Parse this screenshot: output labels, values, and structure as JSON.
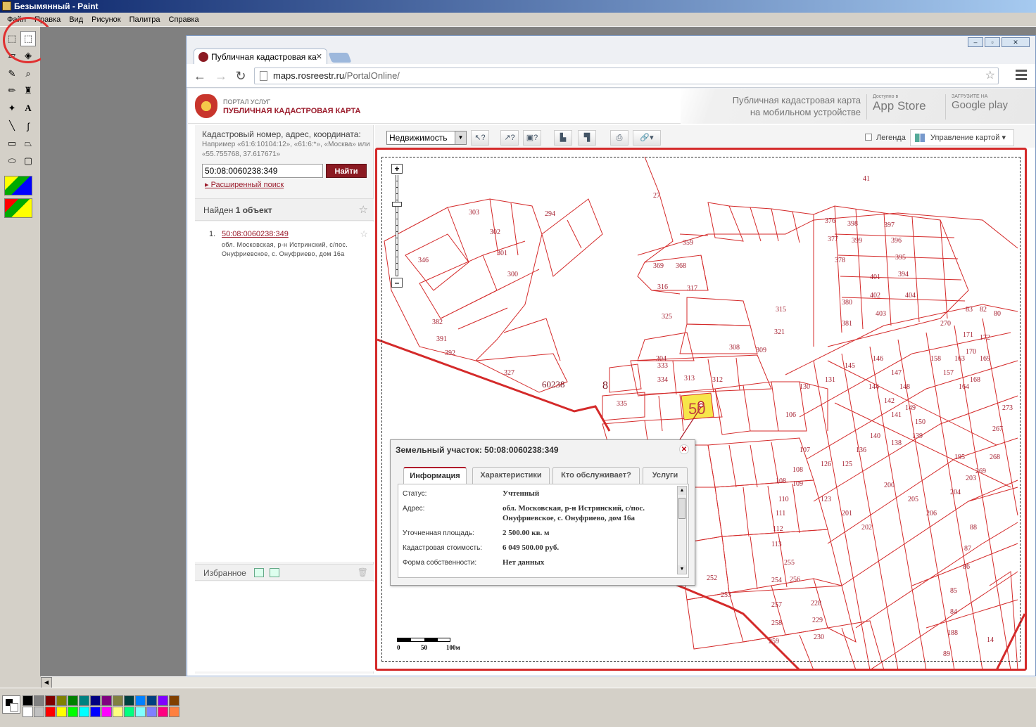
{
  "paint": {
    "title": "Безымянный - Paint",
    "menu": [
      "Файл",
      "Правка",
      "Вид",
      "Рисунок",
      "Палитра",
      "Справка"
    ],
    "palette_colors": [
      "#000000",
      "#808080",
      "#800000",
      "#808000",
      "#008000",
      "#008080",
      "#000080",
      "#800080",
      "#808040",
      "#004040",
      "#0080ff",
      "#004080",
      "#8000ff",
      "#804000",
      "#ffffff",
      "#c0c0c0",
      "#ff0000",
      "#ffff00",
      "#00ff00",
      "#00ffff",
      "#0000ff",
      "#ff00ff",
      "#ffff80",
      "#00ff80",
      "#80ffff",
      "#8080ff",
      "#ff0080",
      "#ff8040"
    ]
  },
  "browser": {
    "tab_title": "Публичная кадастровая ка",
    "url_host": "maps.rosreestr.ru",
    "url_path": "/PortalOnline/"
  },
  "header": {
    "portal_small": "ПОРТАЛ УСЛУГ",
    "portal_big": "ПУБЛИЧНАЯ КАДАСТРОВАЯ КАРТА",
    "mobile_line1": "Публичная кадастровая карта",
    "mobile_line2": "на мобильном устройстве",
    "appstore_small": "Доступно в",
    "appstore_big": "App Store",
    "gplay_small": "ЗАГРУЗИТЕ НА",
    "gplay_big": "Google play"
  },
  "search": {
    "label": "Кадастровый номер, адрес, координата:",
    "hint": "Например «61:6:10104:12», «61:6:*», «Москва» или «55.755768, 37.617671»",
    "value": "50:08:0060238:349",
    "button": "Найти",
    "advanced": "Расширенный поиск"
  },
  "results": {
    "found_prefix": "Найден ",
    "found_count": "1 объект",
    "items": [
      {
        "num": "1.",
        "link": "50:08:0060238:349",
        "address": "обл. Московская, р-н Истринский, с/пос. Онуфриевское, с. Онуфриево, дом 16а"
      }
    ]
  },
  "favorites": {
    "label": "Избранное"
  },
  "map_toolbar": {
    "layer": "Недвижимость",
    "legend": "Легенда",
    "manage": "Управление картой"
  },
  "map": {
    "block_label": "60238",
    "block_label2": "8",
    "selected_parcel": "50",
    "labels_top": [
      {
        "t": "27"
      },
      {
        "t": "41"
      }
    ],
    "scale": {
      "a": "0",
      "b": "50",
      "c": "100м"
    }
  },
  "popup": {
    "title": "Земельный участок: 50:08:0060238:349",
    "tabs": [
      "Информация",
      "Характеристики",
      "Кто обслуживает?",
      "Услуги"
    ],
    "rows": [
      {
        "label": "Статус:",
        "value": "Учтенный"
      },
      {
        "label": "Адрес:",
        "value": "обл. Московская, р-н Истринский, с/пос. Онуфриевское, с. Онуфриево, дом 16а"
      },
      {
        "label": "Уточненная площадь:",
        "value": "2 500.00 кв. м"
      },
      {
        "label": "Кадастровая стоимость:",
        "value": "6 049 500.00 руб."
      },
      {
        "label": "Форма собственности:",
        "value": "Нет данных"
      }
    ]
  },
  "colors": {
    "accent": "#9b1c2c",
    "parcel_line": "#d42a2a",
    "selected_fill": "#f7e64a"
  }
}
